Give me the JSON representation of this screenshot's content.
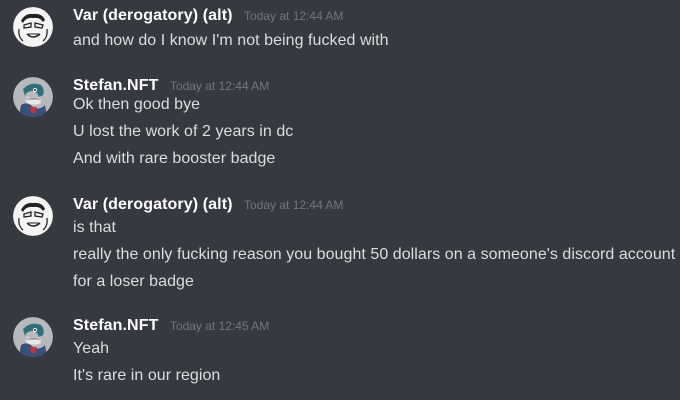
{
  "colors": {
    "background": "#36393f",
    "username": "#ffffff",
    "timestamp": "#72767d",
    "message_text": "#dcddde"
  },
  "messages": [
    {
      "author": "Var (derogatory) (alt)",
      "avatar_icon": "var-avatar-icon",
      "timestamp": "Today at 12:44 AM",
      "lines": [
        "and how do I know I'm not being fucked with"
      ]
    },
    {
      "author": "Stefan.NFT",
      "avatar_icon": "stefan-avatar-icon",
      "timestamp": "Today at 12:44 AM",
      "lines": [
        "Ok then good bye",
        "U lost the work of 2 years in dc",
        "And with rare booster badge"
      ]
    },
    {
      "author": "Var (derogatory) (alt)",
      "avatar_icon": "var-avatar-icon",
      "timestamp": "Today at 12:44 AM",
      "lines": [
        "is that",
        "really the only fucking reason you bought 50 dollars on a someone's discord account",
        "for a loser badge"
      ]
    },
    {
      "author": "Stefan.NFT",
      "avatar_icon": "stefan-avatar-icon",
      "timestamp": "Today at 12:45 AM",
      "lines": [
        "Yeah",
        "It's rare in our region"
      ]
    }
  ]
}
